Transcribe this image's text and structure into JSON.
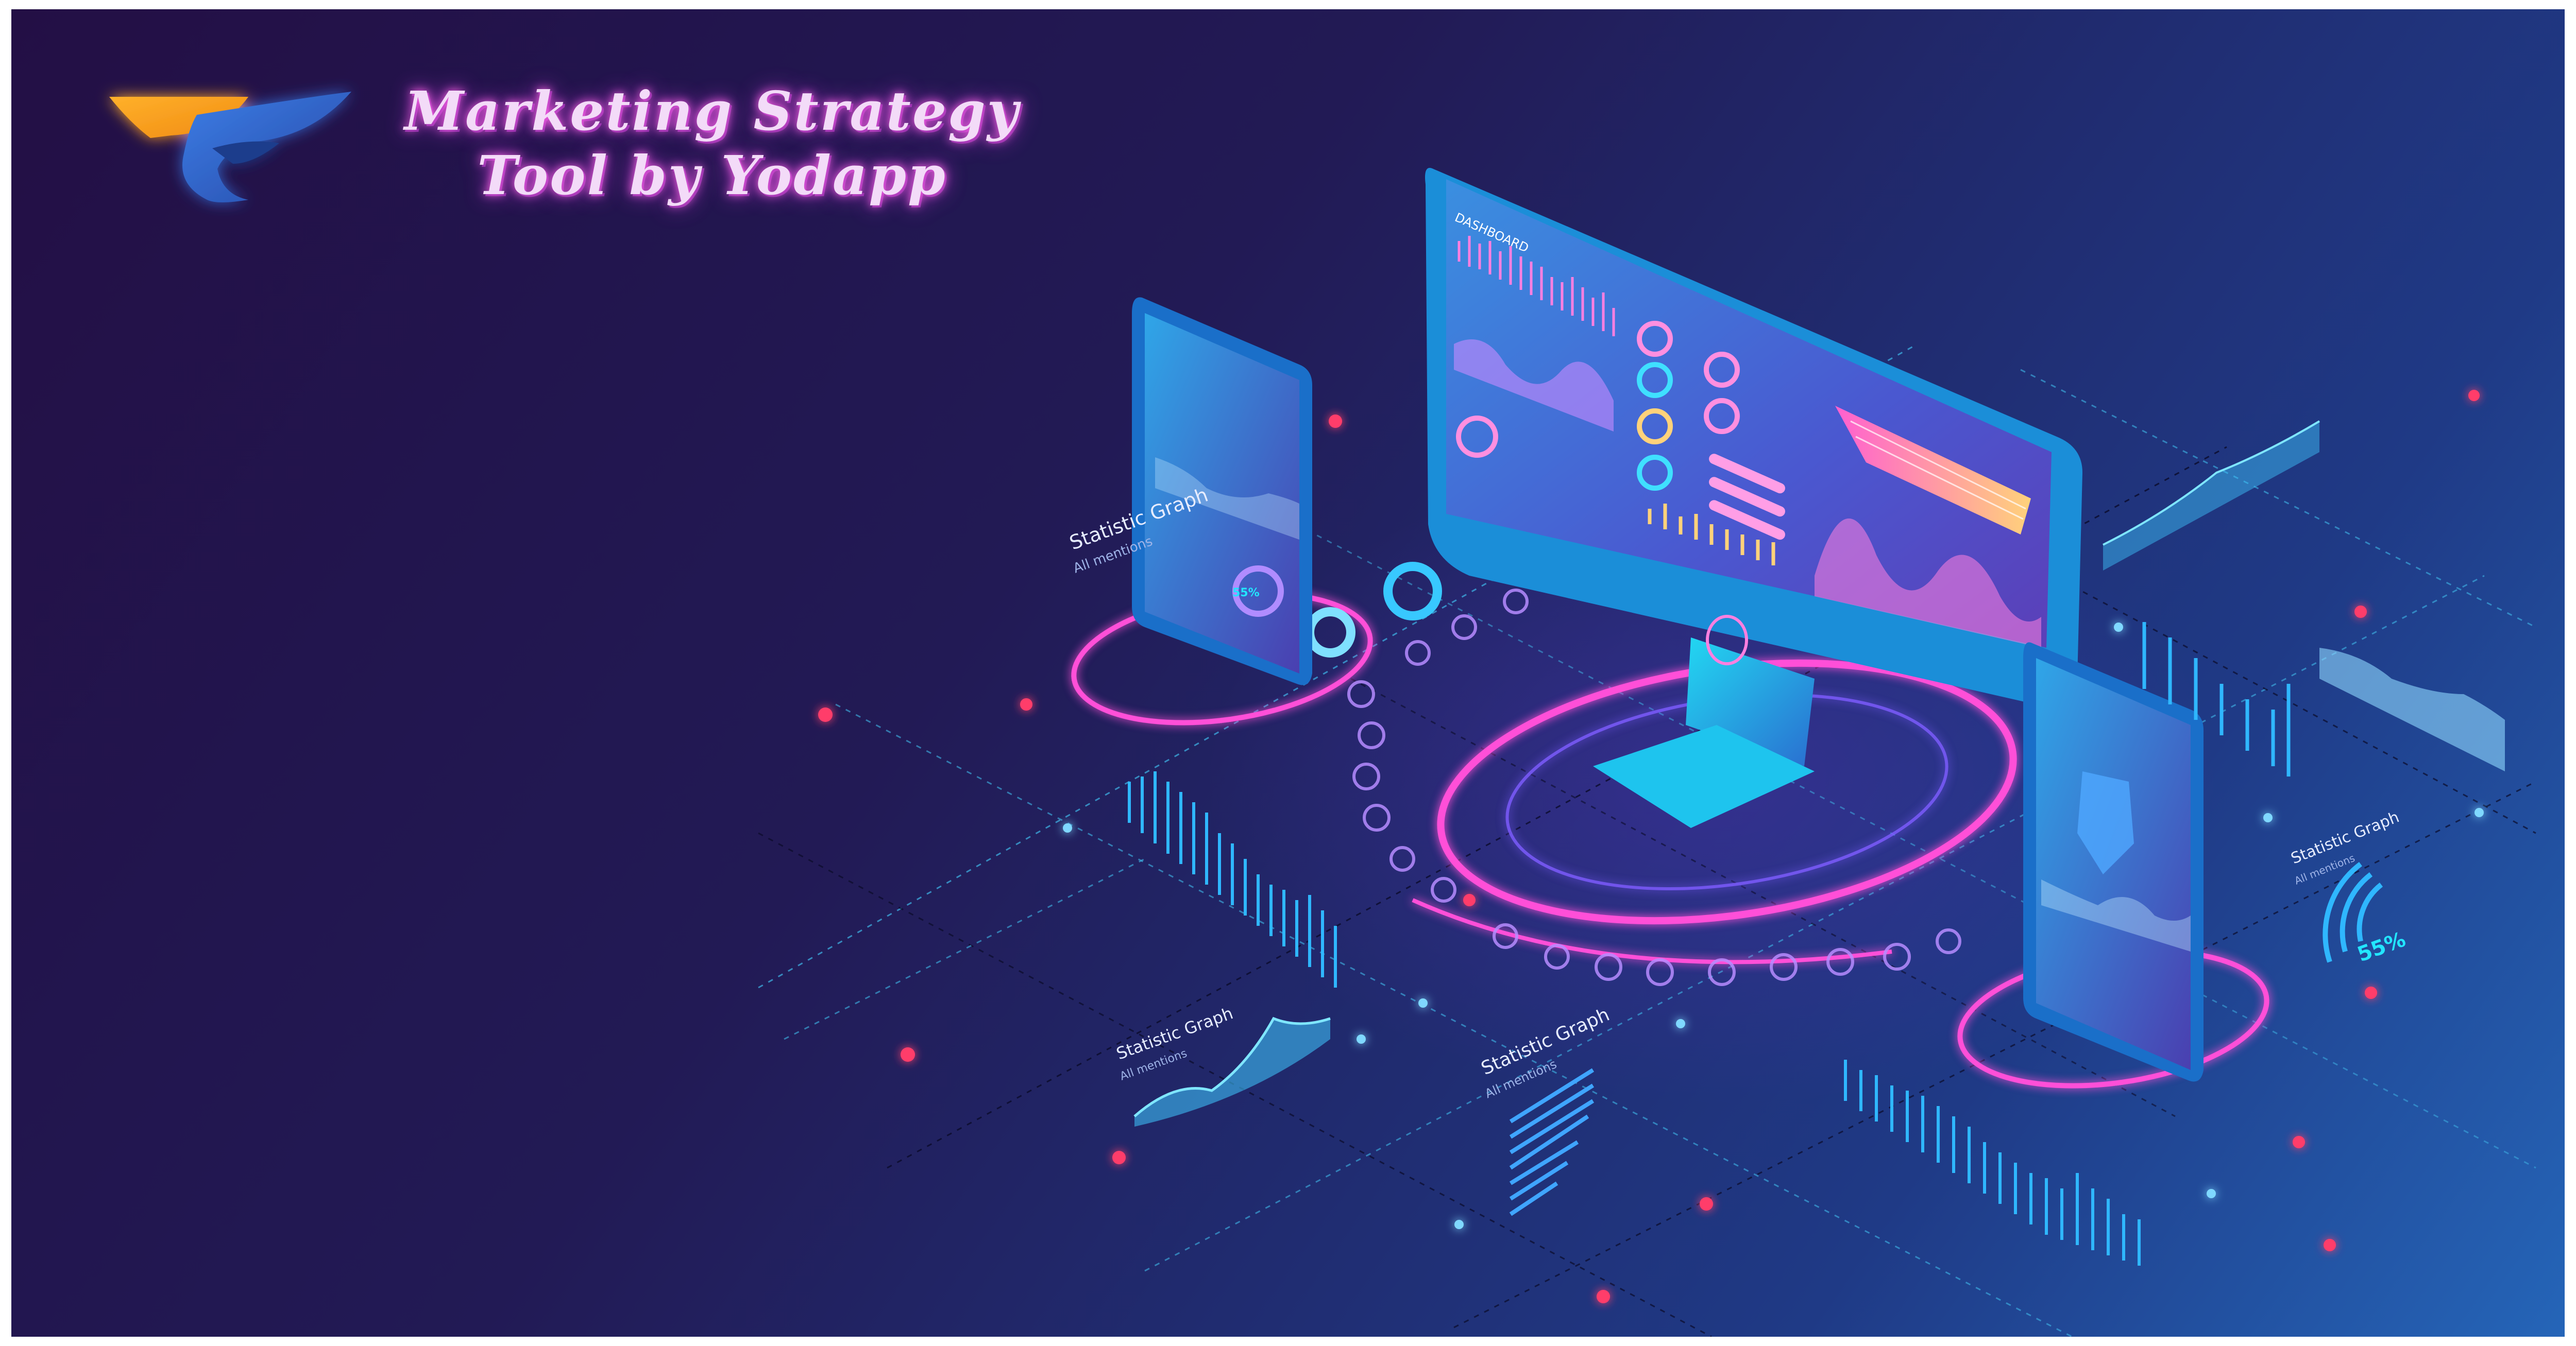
{
  "brand": {
    "title_line1": "Marketing Strategy",
    "title_line2": "Tool by Yodapp"
  },
  "scene": {
    "monitor_label": "DASHBOARD",
    "graphs": [
      {
        "title": "Statistic Graph",
        "subtitle": "All mentions"
      },
      {
        "title": "Statistic Graph",
        "subtitle": "All mentions"
      },
      {
        "title": "Statistic Graph",
        "subtitle": "All mentions"
      },
      {
        "title": "Statistic Graph",
        "subtitle": "All mentions"
      }
    ],
    "gauge_value": "55%",
    "phone_gauge_value": "55%"
  },
  "colors": {
    "bg_dark": "#230f45",
    "bg_light": "#2565b8",
    "neon_pink": "#ff4fd8",
    "neon_cyan": "#22e6ff",
    "logo_orange": "#f6a623",
    "logo_blue": "#2f66c9"
  }
}
